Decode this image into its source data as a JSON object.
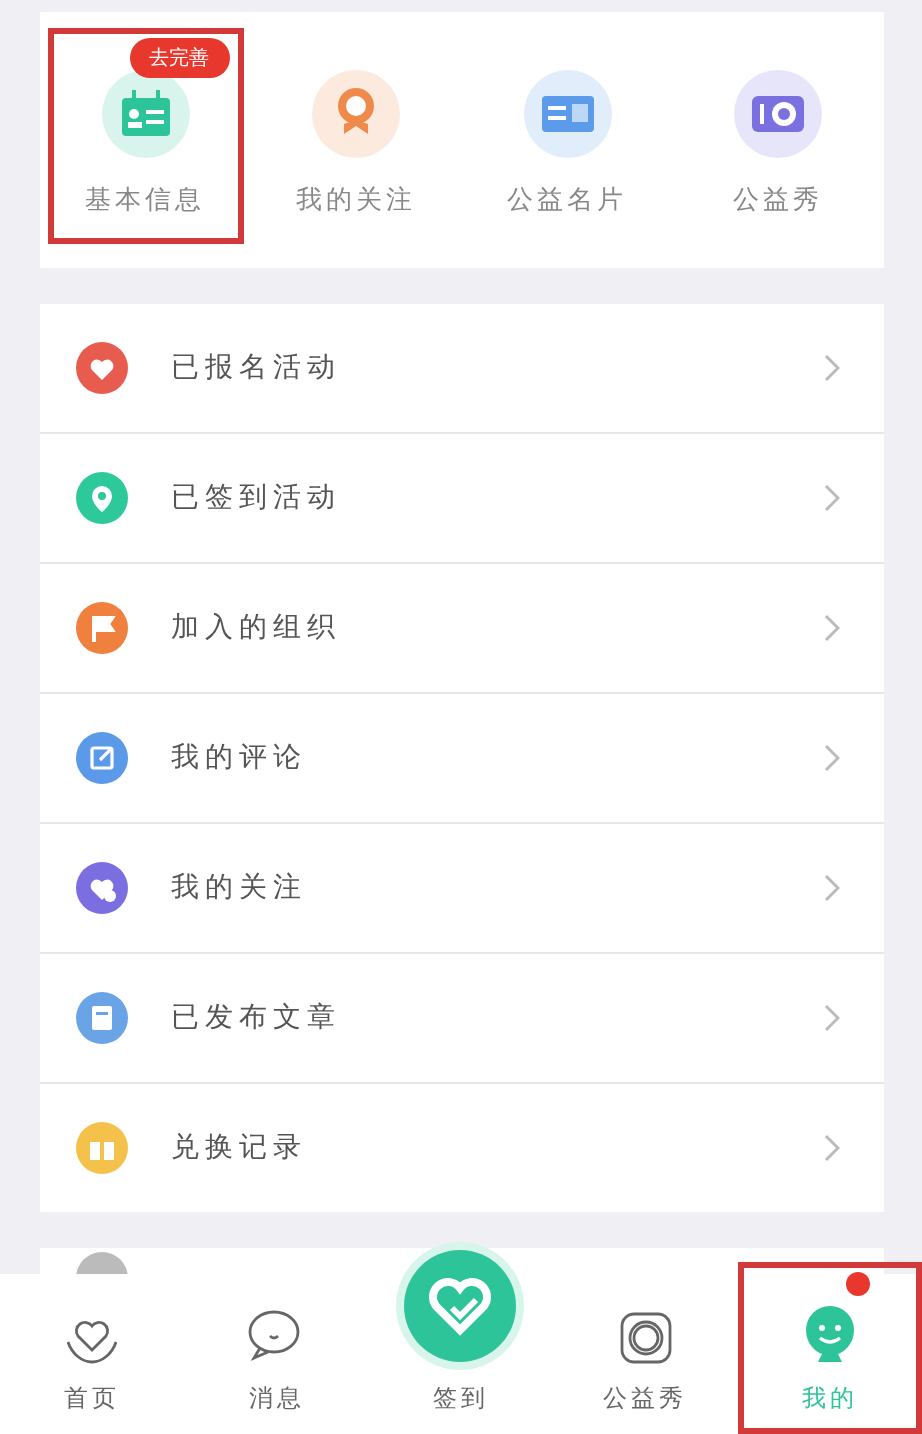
{
  "shortcuts": [
    {
      "label": "基本信息",
      "badge": "去完善",
      "color": "#2ec49a",
      "highlighted": true
    },
    {
      "label": "我的关注",
      "color": "#f08a4b",
      "highlighted": false
    },
    {
      "label": "公益名片",
      "color": "#5b9bea",
      "highlighted": false
    },
    {
      "label": "公益秀",
      "color": "#7b70e0",
      "highlighted": false
    }
  ],
  "menu": [
    {
      "label": "已报名活动",
      "color": "#e85c50"
    },
    {
      "label": "已签到活动",
      "color": "#2ec99a"
    },
    {
      "label": "加入的组织",
      "color": "#f0803e"
    },
    {
      "label": "我的评论",
      "color": "#5a9ae8"
    },
    {
      "label": "我的关注",
      "color": "#7a6ee0"
    },
    {
      "label": "已发布文章",
      "color": "#6aa4e6"
    },
    {
      "label": "兑换记录",
      "color": "#f4c24a"
    }
  ],
  "tabbar": [
    {
      "label": "首页",
      "selected": false,
      "highlighted": false,
      "dot": false
    },
    {
      "label": "消息",
      "selected": false,
      "highlighted": false,
      "dot": false
    },
    {
      "label": "签到",
      "selected": false,
      "highlighted": false,
      "dot": false
    },
    {
      "label": "公益秀",
      "selected": false,
      "highlighted": false,
      "dot": false
    },
    {
      "label": "我的",
      "selected": true,
      "highlighted": true,
      "dot": true
    }
  ]
}
